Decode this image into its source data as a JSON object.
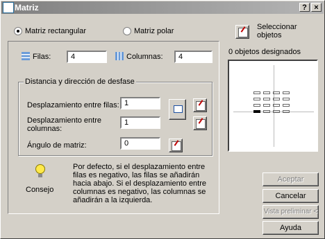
{
  "window": {
    "title": "Matriz",
    "help_btn": "?",
    "close_btn": "×"
  },
  "type_selector": {
    "rectangular_label": "Matriz rectangular",
    "polar_label": "Matriz polar",
    "selected": "rectangular"
  },
  "select_objects": {
    "label": "Seleccionar objetos",
    "status": "0 objetos designados"
  },
  "grid": {
    "rows_label": "Filas:",
    "rows_value": "4",
    "columns_label": "Columnas:",
    "columns_value": "4"
  },
  "offset_group": {
    "caption": "Distancia y dirección de desfase",
    "row_offset_label": "Desplazamiento entre filas:",
    "row_offset_value": "1",
    "col_offset_label": "Desplazamiento entre columnas:",
    "col_offset_value": "1",
    "angle_label": "Ángulo de matriz:",
    "angle_value": "0"
  },
  "tip": {
    "label": "Consejo",
    "text": "Por defecto, si el desplazamiento entre filas es negativo, las filas se añadirán hacia abajo. Si el desplazamiento entre columnas es negativo, las columnas se añadirán a la izquierda."
  },
  "buttons": {
    "ok": "Aceptar",
    "cancel": "Cancelar",
    "preview": "Vista preliminar <",
    "help": "Ayuda"
  }
}
